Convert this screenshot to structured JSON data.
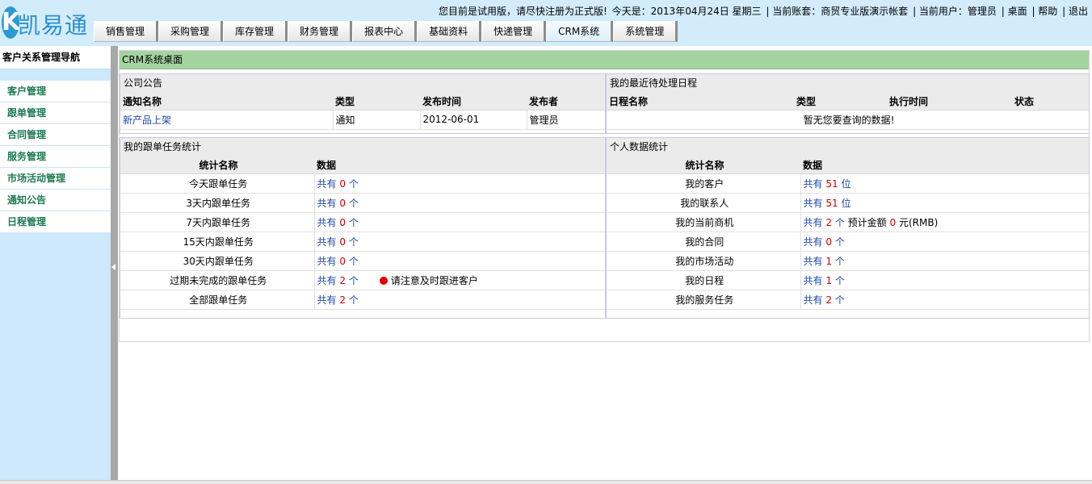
{
  "header": {
    "logo_letter": "K",
    "logo_text": "凯易通",
    "trial_notice": "您目前是试用版，请尽快注册为正式版!",
    "today": "今天是：2013年04月24日   星期三",
    "account": "| 当前账套：商贸专业版演示帐套",
    "user": "| 当前用户：管理员",
    "desktop": "| 桌面",
    "help": "| 帮助",
    "logout": "| 退出"
  },
  "nav": {
    "tabs": [
      "销售管理",
      "采购管理",
      "库存管理",
      "财务管理",
      "报表中心",
      "基础资料",
      "快递管理",
      "CRM系统",
      "系统管理"
    ],
    "active": "CRM系统"
  },
  "sidebar": {
    "title": "客户关系管理导航",
    "items": [
      "客户管理",
      "跟单管理",
      "合同管理",
      "服务管理",
      "市场活动管理",
      "通知公告",
      "日程管理"
    ]
  },
  "content": {
    "title": "CRM系统桌面",
    "announcements": {
      "title": "公司公告",
      "columns": [
        "通知名称",
        "类型",
        "发布时间",
        "发布者"
      ],
      "rows": [
        {
          "name": "新产品上架",
          "type": "通知",
          "date": "2012-06-01",
          "publisher": "管理员"
        }
      ]
    },
    "schedule": {
      "title": "我的最近待处理日程",
      "columns": [
        "日程名称",
        "类型",
        "执行时间",
        "状态"
      ],
      "empty": "暂无您要查询的数据!"
    },
    "followup": {
      "title": "我的跟单任务统计",
      "columns": [
        "统计名称",
        "数据"
      ],
      "rows": [
        {
          "label": "今天跟单任务",
          "prefix": "共有",
          "count": "0",
          "unit": "个"
        },
        {
          "label": "3天内跟单任务",
          "prefix": "共有",
          "count": "0",
          "unit": "个"
        },
        {
          "label": "7天内跟单任务",
          "prefix": "共有",
          "count": "0",
          "unit": "个"
        },
        {
          "label": "15天内跟单任务",
          "prefix": "共有",
          "count": "0",
          "unit": "个"
        },
        {
          "label": "30天内跟单任务",
          "prefix": "共有",
          "count": "0",
          "unit": "个"
        },
        {
          "label": "过期未完成的跟单任务",
          "prefix": "共有",
          "count": "2",
          "unit": "个",
          "note": "请注意及时跟进客户"
        },
        {
          "label": "全部跟单任务",
          "prefix": "共有",
          "count": "2",
          "unit": "个"
        }
      ]
    },
    "personal": {
      "title": "个人数据统计",
      "columns": [
        "统计名称",
        "数据"
      ],
      "rows": [
        {
          "label": "我的客户",
          "prefix": "共有",
          "count": "51",
          "unit": "位"
        },
        {
          "label": "我的联系人",
          "prefix": "共有",
          "count": "51",
          "unit": "位"
        },
        {
          "label": "我的当前商机",
          "prefix": "共有",
          "count": "2",
          "unit": "个",
          "extra_label": "预计金额",
          "extra_value": "0",
          "extra_unit": "元(RMB)"
        },
        {
          "label": "我的合同",
          "prefix": "共有",
          "count": "0",
          "unit": "个"
        },
        {
          "label": "我的市场活动",
          "prefix": "共有",
          "count": "1",
          "unit": "个"
        },
        {
          "label": "我的日程",
          "prefix": "共有",
          "count": "1",
          "unit": "个"
        },
        {
          "label": "我的服务任务",
          "prefix": "共有",
          "count": "2",
          "unit": "个"
        }
      ]
    }
  }
}
